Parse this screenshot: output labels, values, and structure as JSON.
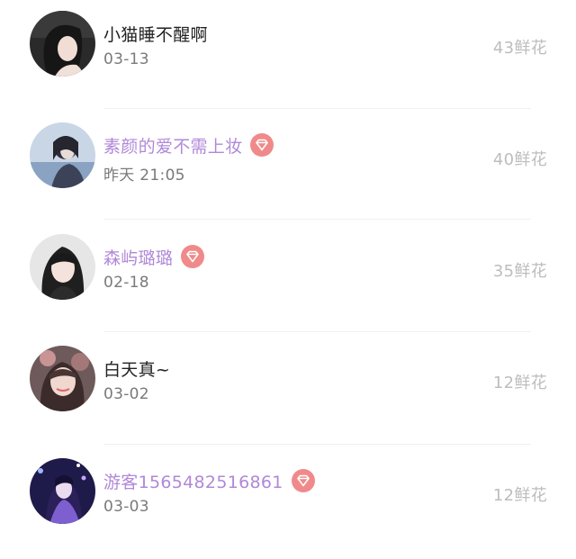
{
  "users": [
    {
      "name": "小猫睡不醒啊",
      "date": "03-13",
      "flowers": "43鲜花",
      "vip": false,
      "avatar_icon": "user-avatar"
    },
    {
      "name": "素颜的爱不需上妆",
      "date": "昨天 21:05",
      "flowers": "40鲜花",
      "vip": true,
      "avatar_icon": "user-avatar"
    },
    {
      "name": "森屿璐璐",
      "date": "02-18",
      "flowers": "35鲜花",
      "vip": true,
      "avatar_icon": "user-avatar"
    },
    {
      "name": "白天真~",
      "date": "03-02",
      "flowers": "12鲜花",
      "vip": false,
      "avatar_icon": "user-avatar"
    },
    {
      "name": "游客1565482516861",
      "date": "03-03",
      "flowers": "12鲜花",
      "vip": true,
      "avatar_icon": "user-avatar"
    }
  ],
  "colors": {
    "vip_name": "#b088d8",
    "plain_name": "#222222",
    "date": "#7a7a7a",
    "flowers": "#bdbdbd",
    "vip_badge": "#f08a8a"
  },
  "icons": {
    "vip_badge": "diamond-vip-icon"
  }
}
